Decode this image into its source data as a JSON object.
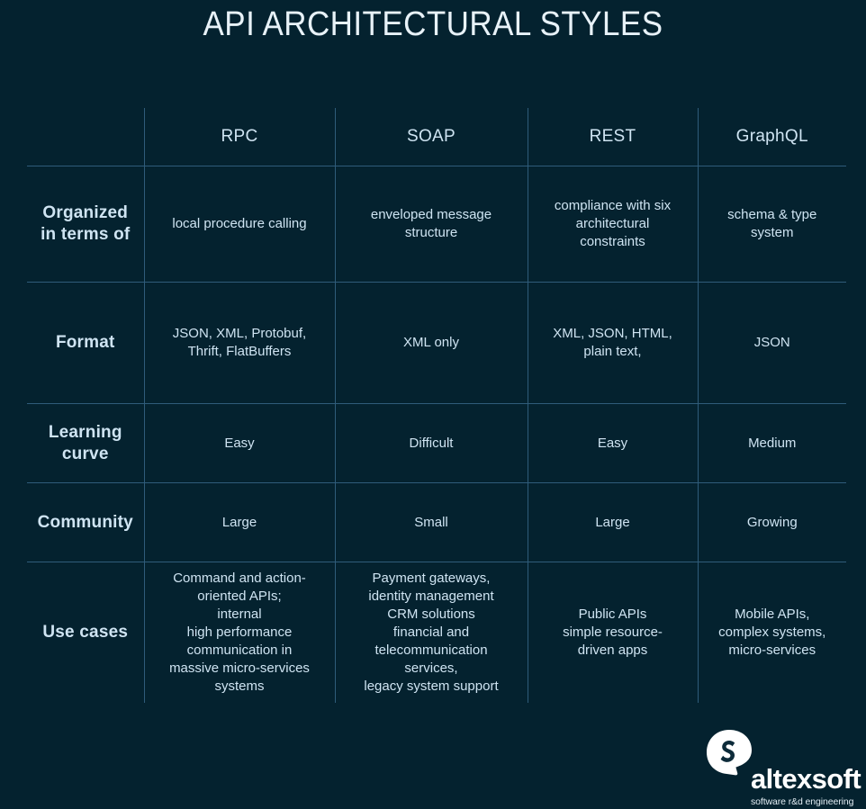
{
  "page": {
    "title": "API ARCHITECTURAL STYLES",
    "background_color": "#04222f",
    "grid_line_color": "#2f5c7a",
    "text_color": "#cfe2f0"
  },
  "colors": {
    "green": "#5cc24c",
    "red": "#fb1111",
    "yellow": "#f6b900",
    "white": "#ffffff"
  },
  "table": {
    "corner_label": "",
    "columns": [
      {
        "label": "RPC"
      },
      {
        "label": "SOAP"
      },
      {
        "label": "REST"
      },
      {
        "label": "GraphQL"
      }
    ],
    "rows": [
      {
        "label": "Organized\nin terms of",
        "cells": [
          {
            "text": "local procedure calling",
            "color": "default"
          },
          {
            "text": "enveloped message\nstructure",
            "color": "default"
          },
          {
            "text": "compliance with six\narchitectural\nconstraints",
            "color": "default"
          },
          {
            "text": "schema & type\nsystem",
            "color": "default"
          }
        ]
      },
      {
        "label": "Format",
        "cells": [
          {
            "text": "JSON, XML, Protobuf,\nThrift, FlatBuffers",
            "color": "default"
          },
          {
            "text": "XML only",
            "color": "red"
          },
          {
            "text": "XML, JSON, HTML,\nplain text,",
            "color": "default"
          },
          {
            "text": "JSON",
            "color": "default"
          }
        ]
      },
      {
        "label": "Learning\ncurve",
        "cells": [
          {
            "text": "Easy",
            "color": "green"
          },
          {
            "text": "Difficult",
            "color": "red"
          },
          {
            "text": "Easy",
            "color": "green"
          },
          {
            "text": "Medium",
            "color": "yellow"
          }
        ]
      },
      {
        "label": "Community",
        "cells": [
          {
            "text": "Large",
            "color": "green"
          },
          {
            "text": "Small",
            "color": "red"
          },
          {
            "text": "Large",
            "color": "green"
          },
          {
            "text": "Growing",
            "color": "yellow"
          }
        ]
      },
      {
        "label": "Use cases",
        "cells": [
          {
            "text": "Command and action-\noriented APIs;\ninternal\nhigh performance\ncommunication in\nmassive micro-services\nsystems",
            "color": "default"
          },
          {
            "text": "Payment gateways,\nidentity management\nCRM solutions\nfinancial and\ntelecommunication\nservices,\nlegacy system support",
            "color": "default"
          },
          {
            "text": "Public APIs\nsimple resource-\ndriven apps",
            "color": "default"
          },
          {
            "text": "Mobile APIs,\ncomplex systems,\nmicro-services",
            "color": "default"
          }
        ]
      }
    ]
  },
  "logo": {
    "mark": "altexsoft-bubble-a-icon",
    "wordmark": "altexsoft",
    "tagline": "software r&d engineering"
  }
}
